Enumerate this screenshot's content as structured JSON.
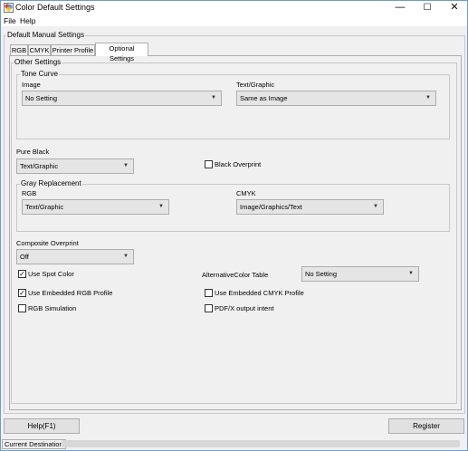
{
  "window": {
    "title": "Color Default Settings",
    "minimize_glyph": "—",
    "maximize_glyph": "☐",
    "close_glyph": "✕"
  },
  "menu": {
    "file": "File",
    "help": "Help"
  },
  "outer_group": {
    "label": "Default Manual Settings"
  },
  "tabs": [
    {
      "label": "RGB"
    },
    {
      "label": "CMYK"
    },
    {
      "label": "Printer Profile"
    },
    {
      "label": "Optional Settings",
      "active": true
    }
  ],
  "other_settings": {
    "label": "Other Settings",
    "tone_curve": {
      "label": "Tone Curve",
      "image_label": "Image",
      "image_value": "No Setting",
      "text_graphic_label": "Text/Graphic",
      "text_graphic_value": "Same as Image"
    },
    "pure_black": {
      "label": "Pure Black",
      "value": "Text/Graphic"
    },
    "black_overprint": {
      "label": "Black Overprint",
      "checked": false
    },
    "gray_replacement": {
      "label": "Gray Replacement",
      "rgb_label": "RGB",
      "rgb_value": "Text/Graphic",
      "cmyk_label": "CMYK",
      "cmyk_value": "Image/Graphics/Text"
    },
    "composite_overprint": {
      "label": "Composite Overprint",
      "value": "Off"
    },
    "use_spot_color": {
      "label": "Use Spot Color",
      "checked": true
    },
    "alternative_color_table": {
      "label": "AlternativeColor Table",
      "value": "No Setting"
    },
    "use_embedded_rgb": {
      "label": "Use Embedded RGB Profile",
      "checked": true
    },
    "use_embedded_cmyk": {
      "label": "Use Embedded CMYK Profile",
      "checked": false
    },
    "rgb_simulation": {
      "label": "RGB Simulation",
      "checked": false
    },
    "pdfx_output_intent": {
      "label": "PDF/X output intent",
      "checked": false
    }
  },
  "buttons": {
    "help": "Help(F1)",
    "register": "Register"
  },
  "status": {
    "label": "Current Destination"
  },
  "glyphs": {
    "check": "✓",
    "combo_arrow": "▼"
  },
  "colors": {
    "title_bar": "#ffffff",
    "window_border": "#6d9ccf",
    "panel": "#f0f0f0"
  }
}
